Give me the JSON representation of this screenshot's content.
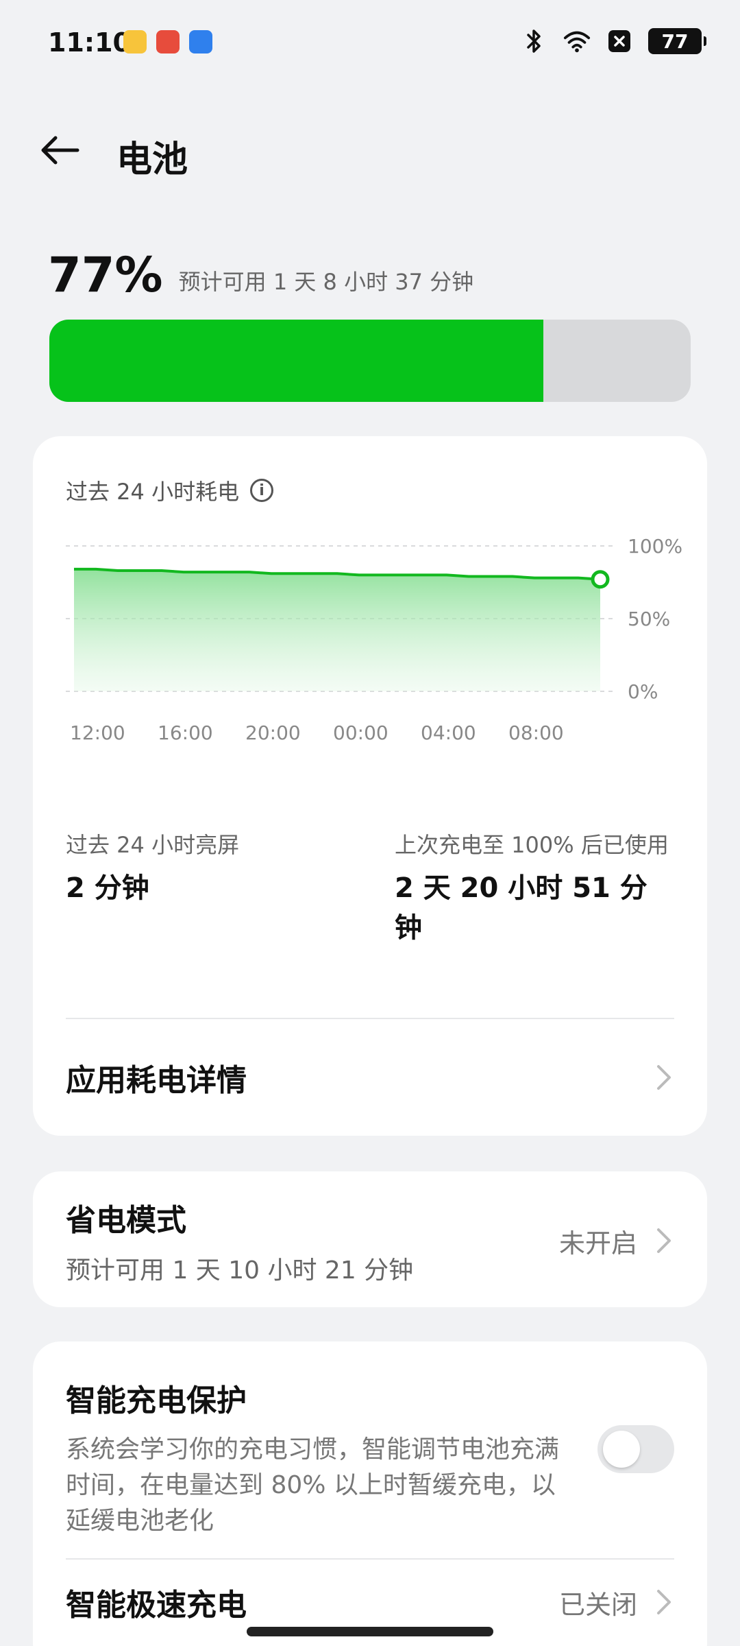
{
  "status_bar": {
    "time": "11:10",
    "notification_icons": [
      "notes-app-icon",
      "red-app-icon",
      "blue-app-icon"
    ],
    "right_icons": [
      "bluetooth-icon",
      "wifi-icon",
      "close-box-icon"
    ],
    "battery": "77"
  },
  "header": {
    "title": "电池",
    "back_icon": "back-arrow-icon"
  },
  "battery": {
    "percent_text": "77%",
    "level": 77,
    "estimate": "预计可用 1 天 8 小时 37 分钟",
    "accent_color": "#06c21a",
    "track_color": "#d8d9db"
  },
  "usage_card": {
    "title": "过去 24 小时耗电",
    "chart_data": {
      "type": "area",
      "title": "过去 24 小时耗电",
      "x": [
        "12:00",
        "13:00",
        "14:00",
        "15:00",
        "16:00",
        "17:00",
        "18:00",
        "19:00",
        "20:00",
        "21:00",
        "22:00",
        "23:00",
        "00:00",
        "01:00",
        "02:00",
        "03:00",
        "04:00",
        "05:00",
        "06:00",
        "07:00",
        "08:00",
        "09:00",
        "10:00",
        "11:00",
        "11:10"
      ],
      "values": [
        84,
        84,
        83,
        83,
        83,
        82,
        82,
        82,
        82,
        81,
        81,
        81,
        81,
        80,
        80,
        80,
        80,
        80,
        79,
        79,
        79,
        78,
        78,
        78,
        77
      ],
      "x_tick_labels": [
        "12:00",
        "16:00",
        "20:00",
        "00:00",
        "04:00",
        "08:00"
      ],
      "y_tick_labels": [
        "100%",
        "50%",
        "0%"
      ],
      "ylim": [
        0,
        100
      ],
      "grid": true
    },
    "stats": {
      "screen_on_label": "过去 24 小时亮屏",
      "screen_on_value": "2 分钟",
      "since_full_label": "上次充电至 100% 后已使用",
      "since_full_value": "2 天 20 小时 51 分钟"
    },
    "app_details_label": "应用耗电详情"
  },
  "power_saving": {
    "title": "省电模式",
    "subtitle": "预计可用 1 天 10 小时 21 分钟",
    "status": "未开启"
  },
  "smart_charging": {
    "title": "智能充电保护",
    "description": "系统会学习你的充电习惯，智能调节电池充满时间，在电量达到 80% 以上时暂缓充电，以延缓电池老化",
    "toggle_on": false
  },
  "fast_charging": {
    "title": "智能极速充电",
    "status": "已关闭"
  }
}
